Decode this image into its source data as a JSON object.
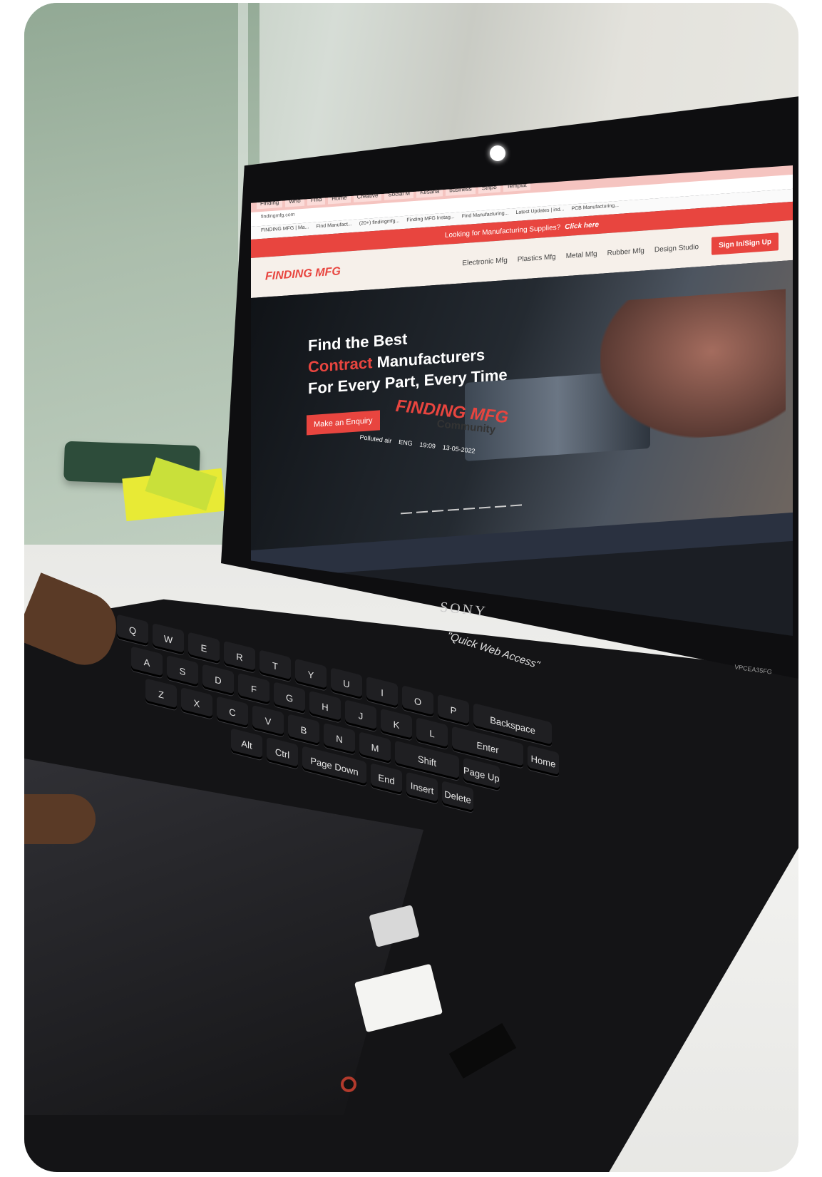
{
  "browser": {
    "tabs": [
      "Finding",
      "Who",
      "Find",
      "Home",
      "Creative",
      "Social M",
      "Kesaria",
      "business",
      "Stripo",
      "Templat"
    ],
    "address": "findingmfg.com",
    "bookmarks": [
      "FINDING MFG | Ma...",
      "Find Manufact...",
      "(20+) findingmfg...",
      "Finding MFG Instag...",
      "Find Manufacturing...",
      "Latest Updates | ind...",
      "PCB Manufacturing..."
    ]
  },
  "site": {
    "promo_text": "Looking for Manufacturing Supplies?",
    "promo_link": "Click here",
    "logo": "FINDING MFG",
    "nav": [
      "Electronic Mfg",
      "Plastics Mfg",
      "Metal Mfg",
      "Rubber Mfg",
      "Design Studio"
    ],
    "signin": "Sign In/Sign Up",
    "hero_line1": "Find the Best",
    "hero_accent": "Contract",
    "hero_line2": " Manufacturers",
    "hero_line3": "For Every Part, Every Time",
    "cta": "Make an Enquiry"
  },
  "taskbar": {
    "weather": "Polluted air",
    "lang": "ENG",
    "time": "19:09",
    "date": "13-05-2022"
  },
  "overlay": {
    "brand": "FINDING MFG",
    "sub": "Community"
  },
  "laptop": {
    "brand": "SONY",
    "model": "VPCEA35FG",
    "quick": "\"Quick Web Access\""
  },
  "keyboard": {
    "row1": [
      "Q",
      "W",
      "E",
      "R",
      "T",
      "Y",
      "U",
      "I",
      "O",
      "P"
    ],
    "row2": [
      "A",
      "S",
      "D",
      "F",
      "G",
      "H",
      "J",
      "K",
      "L"
    ],
    "row3": [
      "Z",
      "X",
      "C",
      "V",
      "B",
      "N",
      "M"
    ],
    "keys": [
      "Alt",
      "Ctrl",
      "Shift",
      "Enter",
      "Backspace",
      "Home",
      "Page Up",
      "Page Down",
      "End",
      "Insert",
      "Delete"
    ]
  }
}
